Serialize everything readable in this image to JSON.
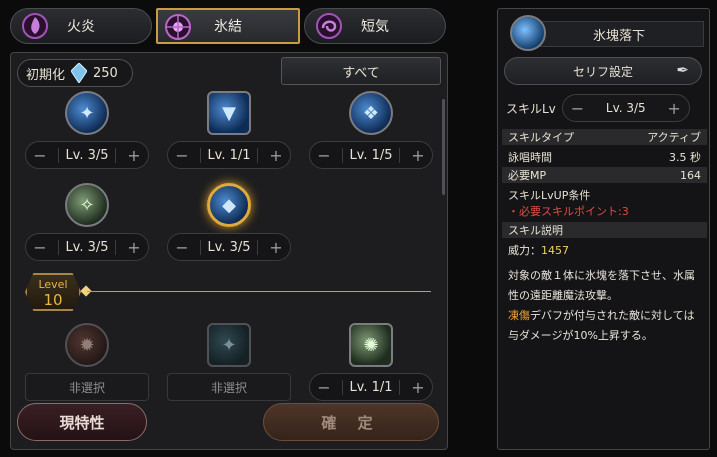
{
  "tabs": [
    {
      "label": "火炎",
      "icon": "fire-emblem-icon"
    },
    {
      "label": "氷結",
      "icon": "ice-emblem-icon",
      "active": true
    },
    {
      "label": "短気",
      "icon": "lightning-emblem-icon"
    }
  ],
  "reset": {
    "label": "初期化",
    "value": "250",
    "icon": "crystal-icon"
  },
  "filter": {
    "label": "すべて"
  },
  "skills": [
    {
      "level": "Lv. 3/5",
      "icon": "ice-spear-icon"
    },
    {
      "level": "Lv. 1/1",
      "icon": "ice-shield-icon"
    },
    {
      "level": "Lv. 1/5",
      "icon": "ice-dragon-icon"
    },
    {
      "level": "Lv. 3/5",
      "icon": "wind-blade-icon"
    },
    {
      "level": "Lv. 3/5",
      "icon": "ice-block-icon"
    },
    {
      "level": "非選択",
      "icon": "flame-figure-icon"
    },
    {
      "level": "非選択",
      "icon": "ice-claw-icon"
    },
    {
      "level": "Lv. 1/1",
      "icon": "glowing-figure-icon"
    }
  ],
  "level_divider": {
    "label": "Level",
    "value": "10"
  },
  "buttons": {
    "trait": "現特性",
    "confirm": "確 定"
  },
  "side": {
    "skill_name": "氷塊落下",
    "dialog_label": "セリフ設定",
    "skill_lv_label": "スキルLv",
    "skill_lv_value": "Lv. 3/5",
    "type_label": "スキルタイプ",
    "type_value": "アクティブ",
    "cast_label": "詠唱時間",
    "cast_value": "3.5 秒",
    "mp_label": "必要MP",
    "mp_value": "164",
    "lvup_label": "スキルLvUP条件",
    "lvup_req": "・必要スキルポイント:3",
    "desc_label": "スキル説明",
    "power_label": "威力：",
    "power_value": "1457",
    "desc_1": "対象の敵１体に氷塊を落下させ、水属",
    "desc_2": "性の遠距離魔法攻撃。",
    "desc_3a": "凍傷",
    "desc_3b": "デバフが付与された敵に対しては",
    "desc_4": "与ダメージが10%上昇する。"
  },
  "colors": {
    "accent_gold": "#c99b46",
    "warning_red": "#e04b46",
    "highlight_orange": "#f0a535"
  }
}
